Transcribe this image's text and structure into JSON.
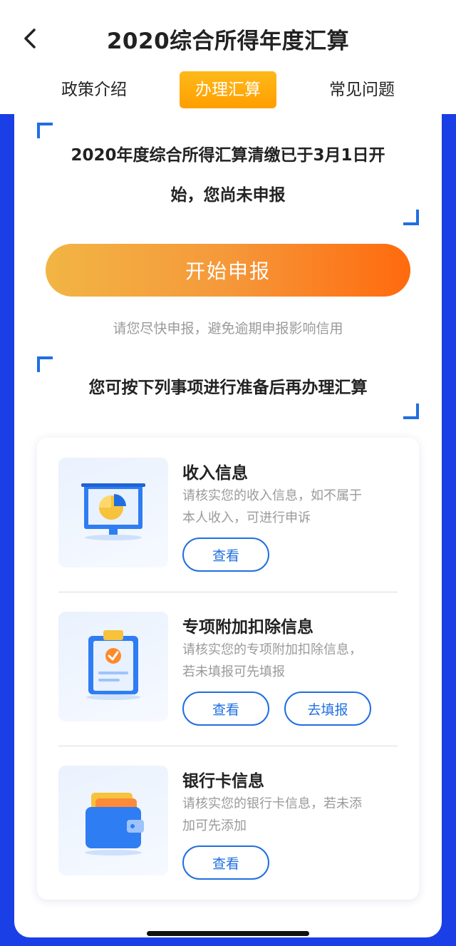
{
  "header": {
    "title": "2020综合所得年度汇算",
    "tabs": [
      {
        "label": "政策介绍"
      },
      {
        "label": "办理汇算"
      },
      {
        "label": "常见问题"
      }
    ]
  },
  "notice": {
    "line1": "2020年度综合所得汇算清缴已于3月1日开",
    "line2": "始，您尚未申报"
  },
  "start_button": {
    "label": "开始申报"
  },
  "hint": "请您尽快申报，避免逾期申报影响信用",
  "prep_title": "您可按下列事项进行准备后再办理汇算",
  "items": [
    {
      "title": "收入信息",
      "desc_line1": "请核实您的收入信息，如不属于",
      "desc_line2": "本人收入，可进行申诉",
      "buttons": [
        "查看"
      ],
      "icon": "chart-board-icon"
    },
    {
      "title": "专项附加扣除信息",
      "desc_line1": "请核实您的专项附加扣除信息，",
      "desc_line2": "若未填报可先填报",
      "buttons": [
        "查看",
        "去填报"
      ],
      "icon": "clipboard-check-icon"
    },
    {
      "title": "银行卡信息",
      "desc_line1": "请核实您的银行卡信息，若未添",
      "desc_line2": "加可先添加",
      "buttons": [
        "查看"
      ],
      "icon": "wallet-icon"
    }
  ],
  "colors": {
    "frame_blue": "#1a3fe6",
    "accent_blue": "#1f6fe0",
    "tab_active": "#ffa90f",
    "button_gradient_start": "#f2b544",
    "button_gradient_end": "#ff6a0d"
  }
}
